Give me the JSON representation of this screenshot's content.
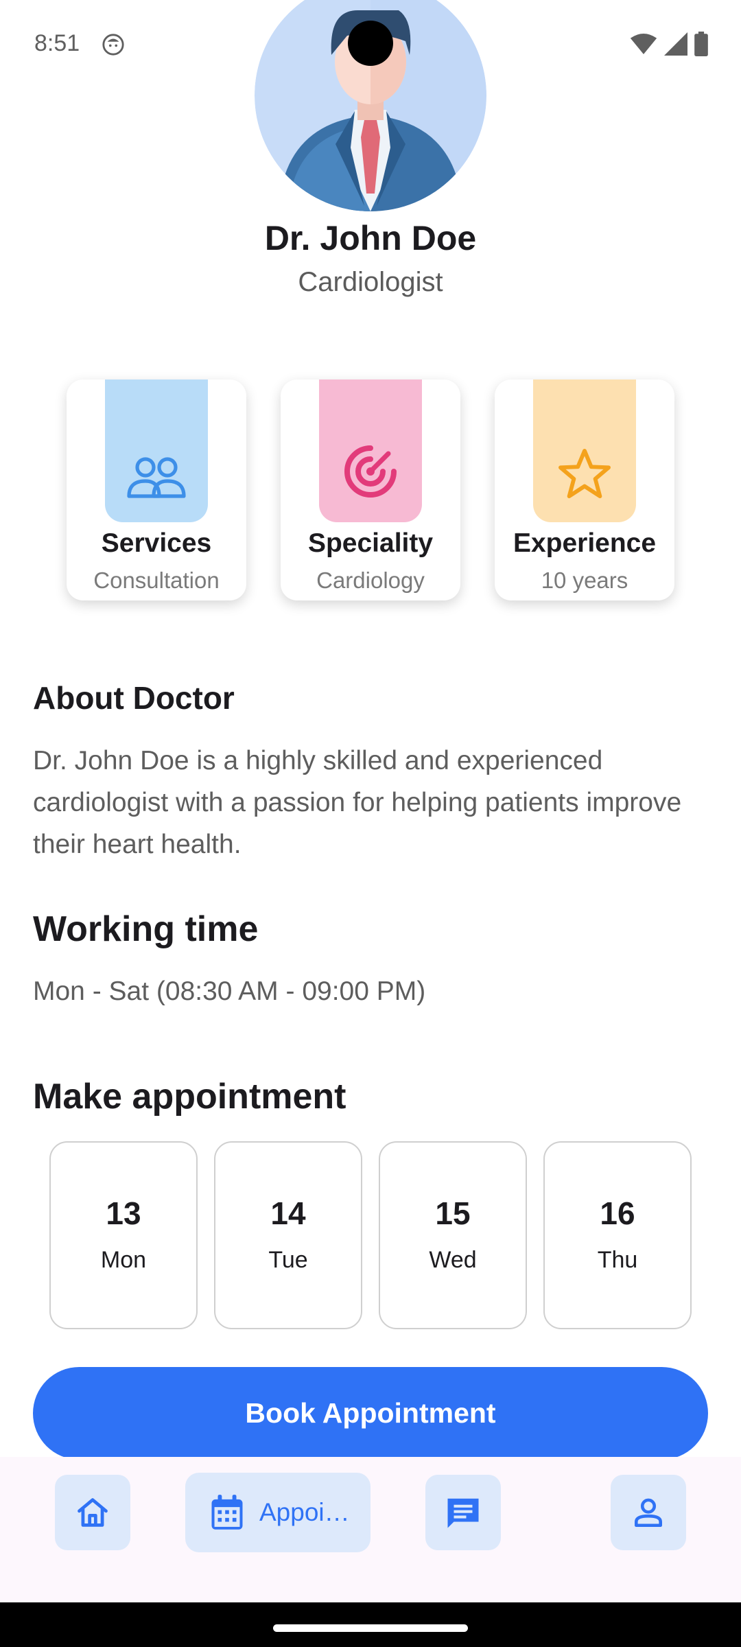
{
  "status_bar": {
    "time": "8:51"
  },
  "doctor": {
    "name": "Dr. John Doe",
    "specialty": "Cardiologist"
  },
  "info_cards": [
    {
      "title": "Services",
      "subtitle": "Consultation",
      "icon": "people-icon",
      "color": "#b8dcf8",
      "icon_color": "#3d8fe8"
    },
    {
      "title": "Speciality",
      "subtitle": "Cardiology",
      "icon": "target-icon",
      "color": "#f7bad3",
      "icon_color": "#e23b7a"
    },
    {
      "title": "Experience",
      "subtitle": "10 years",
      "icon": "star-icon",
      "color": "#fde0b0",
      "icon_color": "#f4a21c"
    }
  ],
  "about": {
    "title": "About Doctor",
    "text": "Dr. John Doe is a highly skilled and experienced cardiologist with a passion for helping patients improve their heart health."
  },
  "working_time": {
    "title": "Working time",
    "text": "Mon - Sat (08:30 AM - 09:00 PM)"
  },
  "appointment": {
    "title": "Make appointment",
    "dates": [
      {
        "num": "13",
        "day": "Mon"
      },
      {
        "num": "14",
        "day": "Tue"
      },
      {
        "num": "15",
        "day": "Wed"
      },
      {
        "num": "16",
        "day": "Thu"
      }
    ],
    "book_label": "Book Appointment"
  },
  "bottom_nav": {
    "items": [
      {
        "icon": "home-icon",
        "label": ""
      },
      {
        "icon": "calendar-icon",
        "label": "Appoi…"
      },
      {
        "icon": "chat-icon",
        "label": ""
      },
      {
        "icon": "person-icon",
        "label": ""
      }
    ]
  },
  "colors": {
    "accent": "#2f72f5",
    "nav_pill": "#dde9fb"
  }
}
